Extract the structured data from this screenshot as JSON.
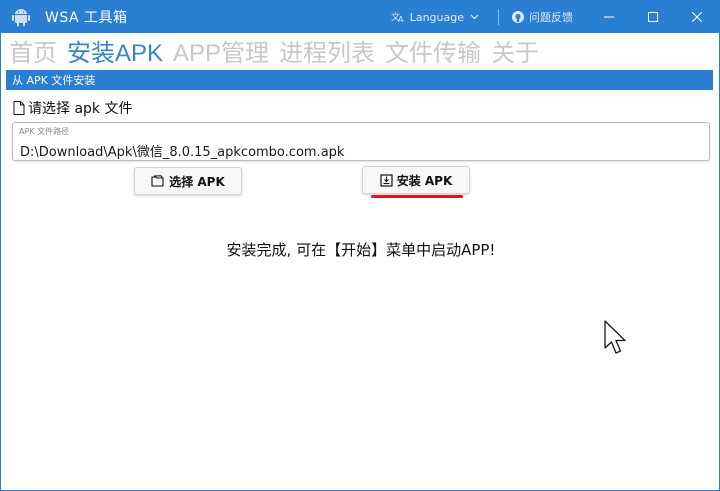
{
  "window": {
    "title": "WSA 工具箱",
    "language_label": "Language",
    "feedback_label": "问题反馈"
  },
  "menu": {
    "tabs": [
      {
        "label": "首页",
        "active": false
      },
      {
        "label": "安装APK",
        "active": true
      },
      {
        "label": "APP管理",
        "active": false
      },
      {
        "label": "进程列表",
        "active": false
      },
      {
        "label": "文件传输",
        "active": false
      },
      {
        "label": "关于",
        "active": false
      }
    ]
  },
  "install": {
    "group_title": "从 APK 文件安装",
    "file_prompt": "请选择 apk 文件",
    "path_label": "APK 文件路径",
    "path_value": "D:\\Download\\Apk\\微信_8.0.15_apkcombo.com.apk",
    "select_button": "选择 APK",
    "install_button": "安装 APK",
    "status_message": "安装完成, 可在【开始】菜单中启动APP!"
  },
  "colors": {
    "accent": "#2b7fd3",
    "active_tab": "#3a85c8",
    "inactive_tab": "#c8c8c8",
    "highlight_underline": "#d61a1a"
  }
}
